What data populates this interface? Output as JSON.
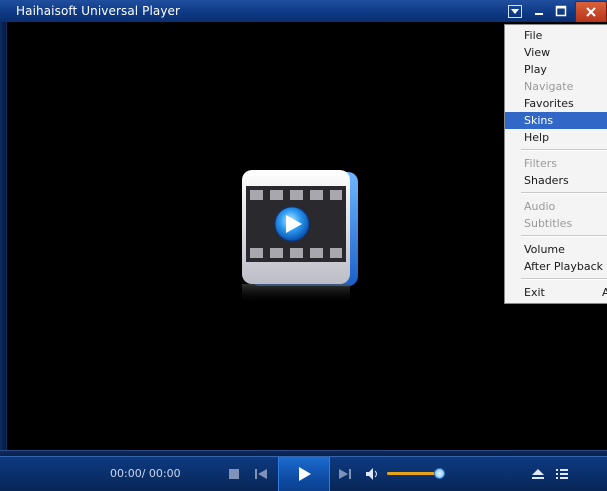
{
  "window": {
    "title": "Haihaisoft Universal Player"
  },
  "titlebar_buttons": [
    "menu-dropdown",
    "minimize",
    "maximize",
    "close"
  ],
  "menu": {
    "items": [
      {
        "label": "File",
        "enabled": true
      },
      {
        "label": "View",
        "enabled": true
      },
      {
        "label": "Play",
        "enabled": true
      },
      {
        "label": "Navigate",
        "enabled": false
      },
      {
        "label": "Favorites",
        "enabled": true
      },
      {
        "label": "Skins",
        "enabled": true,
        "highlighted": true
      },
      {
        "label": "Help",
        "enabled": true
      },
      {
        "label": "Filters",
        "enabled": false
      },
      {
        "label": "Shaders",
        "enabled": true
      },
      {
        "label": "Audio",
        "enabled": false
      },
      {
        "label": "Subtitles",
        "enabled": false
      },
      {
        "label": "Volume",
        "enabled": true
      },
      {
        "label": "After Playback",
        "enabled": true
      },
      {
        "label": "Exit",
        "enabled": true,
        "accelerator": "A"
      }
    ]
  },
  "controls": {
    "time": "00:00/ 00:00",
    "volume_level": 0.9,
    "icons": [
      "stop-icon",
      "previous-icon",
      "play-icon",
      "next-icon",
      "speaker-icon",
      "eject-icon",
      "playlist-icon"
    ]
  },
  "colors": {
    "titlebar": "#0f3a86",
    "controls_bg": "#0a2e68",
    "menu_highlight": "#3168c8",
    "volume_bar": "#e8a316",
    "close_button": "#c8482a"
  }
}
